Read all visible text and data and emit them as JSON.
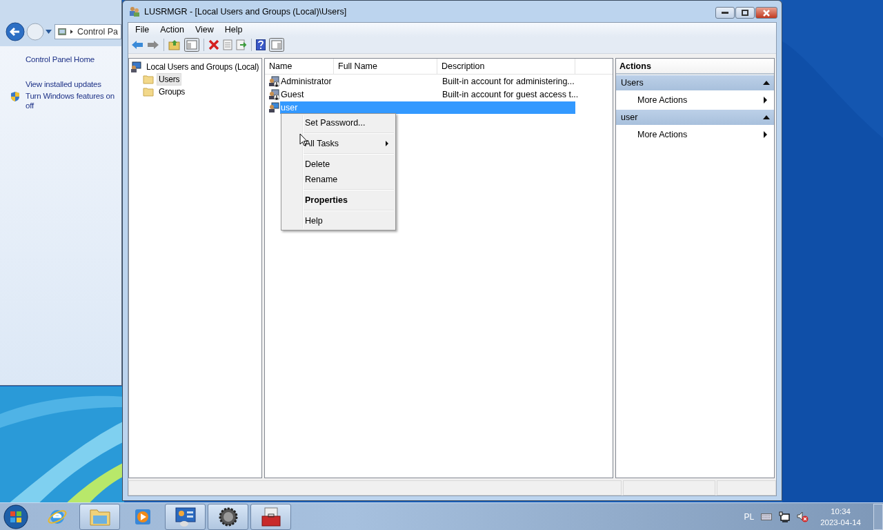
{
  "background_window": {
    "breadcrumb": "Control Pa",
    "links": [
      {
        "lines": [
          "Control Panel Home"
        ],
        "shield": false
      },
      {
        "lines": [
          "View installed updates"
        ],
        "shield": false
      },
      {
        "lines": [
          "Turn Windows features on",
          "off"
        ],
        "shield": true
      }
    ]
  },
  "window": {
    "title": "LUSRMGR - [Local Users and Groups (Local)\\Users]",
    "menu": [
      "File",
      "Action",
      "View",
      "Help"
    ],
    "tree": {
      "label": "Local Users and Groups (Local)",
      "children": [
        {
          "label": "Users",
          "selected": true
        },
        {
          "label": "Groups",
          "selected": false
        }
      ]
    },
    "table": {
      "columns": [
        "Name",
        "Full Name",
        "Description"
      ],
      "rows": [
        {
          "name": "Administrator",
          "description": "Built-in account for administering...",
          "disabled": true,
          "selected": false
        },
        {
          "name": "Guest",
          "description": "Built-in account for guest access t...",
          "disabled": true,
          "selected": false
        },
        {
          "name": "user",
          "disabled": false,
          "selected": true
        }
      ]
    },
    "context_menu": [
      {
        "label": "Set Password...",
        "kind": "item"
      },
      {
        "kind": "separator"
      },
      {
        "label": "All Tasks",
        "kind": "submenu"
      },
      {
        "kind": "separator"
      },
      {
        "label": "Delete",
        "kind": "item"
      },
      {
        "label": "Rename",
        "kind": "item"
      },
      {
        "kind": "separator"
      },
      {
        "label": "Properties",
        "kind": "default"
      },
      {
        "kind": "separator"
      },
      {
        "label": "Help",
        "kind": "item"
      }
    ],
    "actions": {
      "title": "Actions",
      "sections": [
        {
          "title": "Users",
          "expanded": true,
          "items": [
            "More Actions"
          ]
        },
        {
          "title": "user",
          "expanded": true,
          "items": [
            "More Actions"
          ]
        }
      ]
    }
  },
  "taskbar": {
    "items": [
      {
        "kind": "browser",
        "open": false
      },
      {
        "kind": "folder",
        "open": true
      },
      {
        "kind": "media",
        "open": false
      },
      {
        "kind": "panel",
        "open": true
      },
      {
        "kind": "gear",
        "open": true
      },
      {
        "kind": "toolbox",
        "open": true
      }
    ],
    "language": "PL",
    "time": "10:34",
    "date": "2023-04-14"
  }
}
